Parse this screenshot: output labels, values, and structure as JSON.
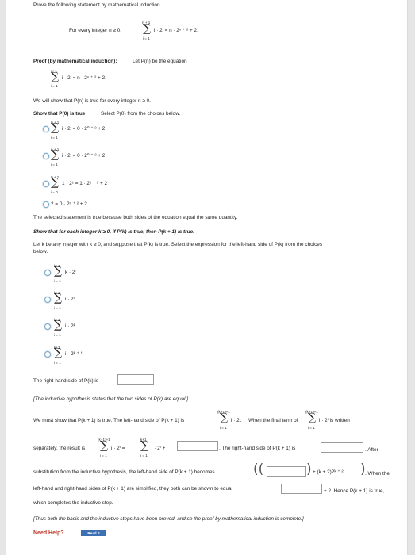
{
  "prompt": "Prove the following statement by mathematical induction.",
  "statement": {
    "lead": "For every integer n ≥ 0,",
    "upper": "n + 1",
    "lower": "i = 1",
    "body": "i · 2ⁱ = n · 2ⁿ ⁺ ² + 2."
  },
  "proof_heading": "Proof (by mathematical induction):",
  "proof_text": "Let P(n) be the equation",
  "eq": {
    "upper": "n+1",
    "lower": "i = 1",
    "body": "i · 2ⁱ = n · 2ⁿ ⁺ ² + 2."
  },
  "show_all": "We will show that P(n) is true for every integer n ≥ 0.",
  "base_heading": "Show that P(0) is true:",
  "base_instruction": "Select P(0) from the choices below.",
  "base_choices": [
    {
      "upper": "0 + 1",
      "lower": "i = 1",
      "body": "i · 2ⁱ = 0 · 2⁰ ⁺ ² + 2"
    },
    {
      "upper": "n + 1",
      "lower": "i = 1",
      "body": "i · 2ⁱ = 0 · 2⁰ ⁺ ² + 2"
    },
    {
      "upper": "0 + 1",
      "lower": "i = 0",
      "body": "1 · 2¹ = 1 · 2¹ ⁺ ² + 2"
    },
    {
      "upper": "",
      "lower": "",
      "body": "2 = 0 · 2ⁿ ⁺ ² + 2"
    }
  ],
  "base_conclusion": "The selected statement is true because both sides of the equation equal the same quantity.",
  "inductive_heading": "Show that for each integer k ≥ 0, if P(k) is true, then P(k + 1) is true:",
  "inductive_instruction_1": "Let k be any integer with k ≥ 0, and suppose that P(k) is true. Select the expression for the left-hand side of P(k) from the choices",
  "inductive_instruction_2": "below.",
  "lhs_choices": [
    {
      "upper": "k+1",
      "lower": "i = 1",
      "body": "k · 2ⁱ"
    },
    {
      "upper": "k+1",
      "lower": "i = 1",
      "body": "i · 2ⁱ"
    },
    {
      "upper": "k+1",
      "lower": "i = 1",
      "body": "i · 2ᵏ"
    },
    {
      "upper": "k+1",
      "lower": "i = 1",
      "body": "i · 2ᵏ ⁺ ¹"
    }
  ],
  "rhs_label": "The right-hand side of P(k) is",
  "hypothesis_note": "[The inductive hypothesis states that the two sides of P(k) are equal.]",
  "must_show_1": "We must show that P(k + 1) is true. The left-hand side of P(k + 1) is",
  "must_show_sum": {
    "upper": "(k+1)+1",
    "lower": "i = 1",
    "body": "i · 2ⁱ."
  },
  "must_show_2": "When the final term of",
  "final_term_sum": {
    "upper": "(k+1)+1",
    "lower": "i = 1",
    "body": "i · 2ⁱ is written"
  },
  "separately_lead": "separately, the result is",
  "sep_sum_1": {
    "upper": "(k+1)+1",
    "lower": "i = 1",
    "body": "i · 2ⁱ ="
  },
  "sep_sum_2": {
    "upper": "k+1",
    "lower": "i = 1",
    "body": "i · 2ⁱ +"
  },
  "rhs_k1_label": ". The right-hand side of P(k + 1) is",
  "after": ". After",
  "substitution_text": "substitution from the inductive hypothesis, the left-hand side of P(k + 1) becomes",
  "becomes_tail": "+ (k + 2)2ᵏ ⁺ ²",
  "when_the": ". When the",
  "simplified_text": "left-hand and right-hand sides of P(k + 1) are simplified, they both can be shown to equal",
  "hence": "+ 2. Hence P(k + 1) is true,",
  "completes": "which completes the inductive step.",
  "final_note": "[Thus both the basis and the inductive steps have been proved, and so the proof by mathematical induction is complete.]",
  "need_help": "Need Help?",
  "read_it": "Read It"
}
